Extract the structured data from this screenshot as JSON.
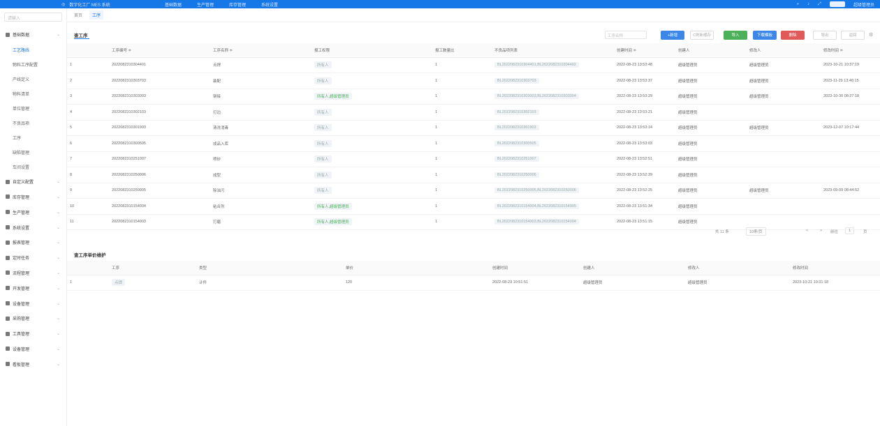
{
  "topbar": {
    "brand": "数字化工厂 MES 系统",
    "menu": [
      "基础数据",
      "生产管理",
      "库存管理",
      "系统设置"
    ],
    "user_name": "超级管理员"
  },
  "sidebar": {
    "search_placeholder": "请输入",
    "items": [
      {
        "label": "基础数据",
        "icon": "grid-icon",
        "expanded": true,
        "children": [
          "工艺路线",
          "物料工序配置",
          "产线定义",
          "物料清单",
          "单位管理",
          "不良品项",
          "工序",
          "缺陷管理",
          "车间设置"
        ]
      },
      {
        "label": "自定义配置",
        "icon": "gear-icon"
      },
      {
        "label": "库存管理",
        "icon": "box-icon"
      },
      {
        "label": "生产管理",
        "icon": "gear-icon"
      },
      {
        "label": "系统设置",
        "icon": "grid-icon"
      },
      {
        "label": "报表管理",
        "icon": "chart-icon"
      },
      {
        "label": "定时任务",
        "icon": "clock-icon"
      },
      {
        "label": "流程管理",
        "icon": "flow-icon"
      },
      {
        "label": "开发管理",
        "icon": "code-icon"
      },
      {
        "label": "设备管理",
        "icon": "device-icon"
      },
      {
        "label": "采购管理",
        "icon": "cart-icon"
      },
      {
        "label": "工具管理",
        "icon": "tool-icon"
      },
      {
        "label": "设备管理",
        "icon": "device-icon"
      },
      {
        "label": "看板管理",
        "icon": "board-icon"
      }
    ]
  },
  "tabs": [
    "首页",
    "工序"
  ],
  "panel": {
    "title": "查工序",
    "search_placeholder": "工序名称",
    "buttons": [
      "+新增",
      "C刷新缓存",
      "导入",
      "下载模板",
      "删除",
      "导出",
      "返回"
    ]
  },
  "table": {
    "headers": [
      "",
      "工序编号 ≑",
      "工序名称 ≑",
      "报工权限",
      "报工数量比",
      "不良品项列表",
      "创建时间 ≑",
      "创建人",
      "修改人",
      "修改时间 ≑"
    ],
    "rows": [
      {
        "idx": "1",
        "code": "2022082310304401",
        "name": "点焊",
        "perm": "所有人",
        "ratio": "1",
        "defects": "BL2022082310304401,BL2022082310304402",
        "created": "2022-08-23 13:53:48",
        "creator": "超级管理员",
        "modifier": "超级管理员",
        "modified": "2023-10-21 10:37:19"
      },
      {
        "idx": "2",
        "code": "2022082310303703",
        "name": "装配",
        "perm": "所有人",
        "ratio": "1",
        "defects": "BL2022082310303703",
        "created": "2022-08-23 13:53:37",
        "creator": "超级管理员",
        "modifier": "超级管理员",
        "modified": "2023-11-29 13:46:15"
      },
      {
        "idx": "3",
        "code": "2022082310303003",
        "name": "铆接",
        "perm": "所有人,超级管理员",
        "ratio": "1",
        "defects": "BL2022082310303003,BL2022082310303004",
        "created": "2022-08-23 13:53:29",
        "creator": "超级管理员",
        "modifier": "超级管理员",
        "modified": "2023-10-30 08:27:18"
      },
      {
        "idx": "4",
        "code": "2022082310302103",
        "name": "打边",
        "perm": "所有人",
        "ratio": "1",
        "defects": "BL2022082310302103",
        "created": "2022-08-23 13:53:21",
        "creator": "超级管理员",
        "modifier": "",
        "modified": ""
      },
      {
        "idx": "5",
        "code": "2022082310301903",
        "name": "清洗消毒",
        "perm": "所有人",
        "ratio": "1",
        "defects": "BL2022082310301903",
        "created": "2022-08-23 13:53:14",
        "creator": "超级管理员",
        "modifier": "超级管理员",
        "modified": "2023-12-07 10:17:44"
      },
      {
        "idx": "6",
        "code": "2022082310300505",
        "name": "成品入库",
        "perm": "所有人",
        "ratio": "1",
        "defects": "BL2022082310300505",
        "created": "2022-08-23 13:53:03",
        "creator": "超级管理员",
        "modifier": "",
        "modified": ""
      },
      {
        "idx": "7",
        "code": "2022082310251007",
        "name": "喷砂",
        "perm": "所有人",
        "ratio": "1",
        "defects": "BL2022082310251007",
        "created": "2022-08-23 13:52:51",
        "creator": "超级管理员",
        "modifier": "",
        "modified": ""
      },
      {
        "idx": "8",
        "code": "2022082310250006",
        "name": "成型",
        "perm": "所有人",
        "ratio": "1",
        "defects": "BL2022082310250006",
        "created": "2022-08-23 13:52:39",
        "creator": "超级管理员",
        "modifier": "",
        "modified": ""
      },
      {
        "idx": "9",
        "code": "2022082310250005",
        "name": "除油污",
        "perm": "所有人",
        "ratio": "1",
        "defects": "BL2022082310250005,BL2022082310250006",
        "created": "2022-08-23 13:52:25",
        "creator": "超级管理员",
        "modifier": "超级管理员",
        "modified": "2023-09-09 08:44:52"
      },
      {
        "idx": "10",
        "code": "2022082310154004",
        "name": "粘合剂",
        "perm": "所有人,超级管理员",
        "ratio": "1",
        "defects": "BL2022082310154004,BL2022082310154005",
        "created": "2022-08-23 13:51:34",
        "creator": "超级管理员",
        "modifier": "",
        "modified": ""
      },
      {
        "idx": "11",
        "code": "2022082310154003",
        "name": "打磨",
        "perm": "所有人,超级管理员",
        "ratio": "1",
        "defects": "BL2022082310154003,BL2022082310154004",
        "created": "2022-08-23 13:51:15",
        "creator": "超级管理员",
        "modifier": "",
        "modified": ""
      }
    ]
  },
  "pager": {
    "total": "共 11 条",
    "page_size": "10条/页",
    "prev": "<",
    "next": ">",
    "goto_label": "前往",
    "page": "1",
    "unit": "页"
  },
  "panel2": {
    "title": "查工序单价维护",
    "headers": [
      "",
      "工序",
      "类型",
      "单价",
      "创建时间",
      "创建人",
      "修改人",
      "修改时间"
    ],
    "rows": [
      {
        "idx": "1",
        "process": "点焊",
        "type": "计件",
        "price": "120",
        "created": "2022-08-23 10:51:51",
        "creator": "超级管理员",
        "modifier": "超级管理员",
        "modified": "2023-10-21 10:31:18"
      }
    ]
  }
}
